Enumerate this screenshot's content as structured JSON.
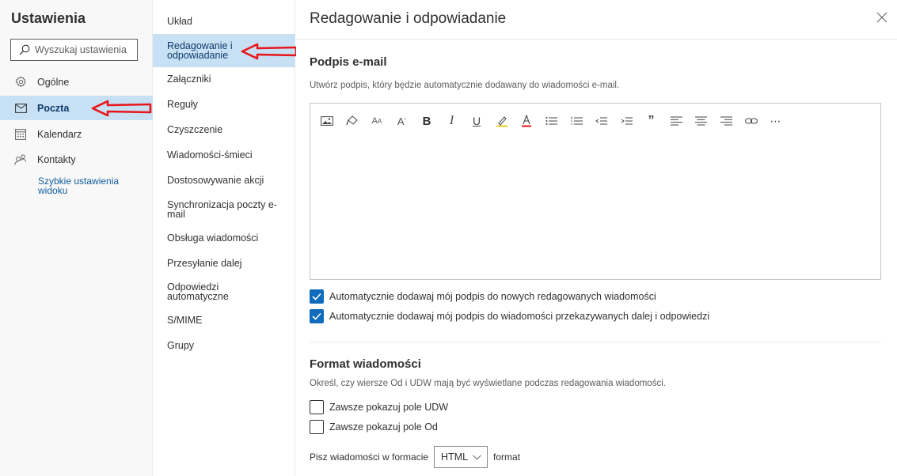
{
  "sidebar": {
    "title": "Ustawienia",
    "search_placeholder": "Wyszukaj ustawienia",
    "categories": [
      {
        "label": "Ogólne",
        "icon": "gear-icon"
      },
      {
        "label": "Poczta",
        "icon": "mail-icon",
        "active": true
      },
      {
        "label": "Kalendarz",
        "icon": "calendar-icon"
      },
      {
        "label": "Kontakty",
        "icon": "people-icon"
      }
    ],
    "quick_settings": "Szybkie ustawienia widoku"
  },
  "mail_menu": {
    "items": [
      "Układ",
      "Redagowanie i odpowiadanie",
      "Załączniki",
      "Reguły",
      "Czyszczenie",
      "Wiadomości-śmieci",
      "Dostosowywanie akcji",
      "Synchronizacja poczty e-mail",
      "Obsługa wiadomości",
      "Przesyłanie dalej",
      "Odpowiedzi automatyczne",
      "S/MIME",
      "Grupy"
    ],
    "active_index": 1
  },
  "main": {
    "title": "Redagowanie i odpowiadanie",
    "signature": {
      "heading": "Podpis e-mail",
      "description": "Utwórz podpis, który będzie automatycznie dodawany do wiadomości e-mail.",
      "toolbar_icons": [
        "image-icon",
        "format-painter-icon",
        "font-size-icon",
        "superscript-icon",
        "bold-icon",
        "italic-icon",
        "underline-icon",
        "highlight-icon",
        "font-color-icon",
        "bullets-icon",
        "numbering-icon",
        "decrease-indent-icon",
        "increase-indent-icon",
        "quote-icon",
        "align-left-icon",
        "align-center-icon",
        "align-right-icon",
        "link-icon",
        "more-icon"
      ],
      "auto_new": {
        "label": "Automatycznie dodawaj mój podpis do nowych redagowanych wiadomości",
        "checked": true
      },
      "auto_reply": {
        "label": "Automatycznie dodawaj mój podpis do wiadomości przekazywanych dalej i odpowiedzi",
        "checked": true
      }
    },
    "format": {
      "heading": "Format wiadomości",
      "description": "Określ, czy wiersze Od i UDW mają być wyświetlane podczas redagowania wiadomości.",
      "show_bcc": {
        "label": "Zawsze pokazuj pole UDW",
        "checked": false
      },
      "show_from": {
        "label": "Zawsze pokazuj pole Od",
        "checked": false
      },
      "compose_prefix": "Pisz wiadomości w formacie",
      "compose_value": "HTML",
      "compose_suffix": "format"
    }
  },
  "colors": {
    "accent": "#0f6cbd",
    "selected_bg": "#c7e0f4",
    "annotation_arrow": "#e8161b"
  }
}
